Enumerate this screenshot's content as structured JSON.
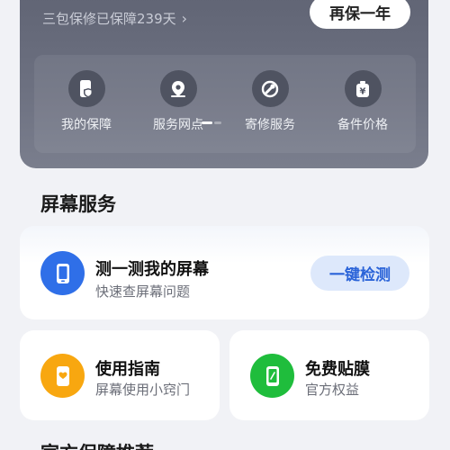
{
  "warranty": {
    "status_text": "三包保修已保障239天",
    "renew_label": "再保一年"
  },
  "quick_actions": [
    {
      "label": "我的保障",
      "icon": "phone-shield-icon"
    },
    {
      "label": "服务网点",
      "icon": "map-pin-icon"
    },
    {
      "label": "寄修服务",
      "icon": "wrench-icon"
    },
    {
      "label": "备件价格",
      "icon": "price-tag-icon"
    }
  ],
  "screen_service": {
    "section_title": "屏幕服务",
    "test": {
      "title": "测一测我的屏幕",
      "subtitle": "快速查屏幕问题",
      "button": "一键检测",
      "icon": "phone-screen-icon",
      "color": "#2f6fe8"
    },
    "guide": {
      "title": "使用指南",
      "subtitle": "屏幕使用小窍门",
      "icon": "phone-heart-icon",
      "color": "#f8a710"
    },
    "film": {
      "title": "免费贴膜",
      "subtitle": "官方权益",
      "icon": "phone-film-icon",
      "color": "#1fbd3c"
    }
  },
  "next_section_title": "官方保障推荐"
}
